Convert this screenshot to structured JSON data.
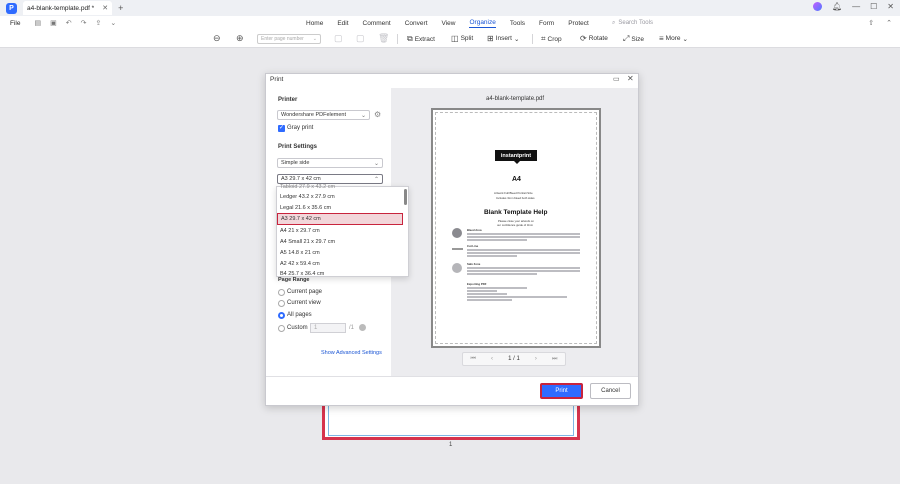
{
  "app": {
    "tab_title": "a4-blank-template.pdf *",
    "logo_letter": "P"
  },
  "menu": {
    "file": "File",
    "items": [
      "Home",
      "Edit",
      "Comment",
      "Convert",
      "View",
      "Organize",
      "Tools",
      "Form",
      "Protect"
    ],
    "active": "Organize",
    "search_placeholder": "Search Tools"
  },
  "toolbar": {
    "page_number_placeholder": "Enter page number",
    "extract": "Extract",
    "split": "Split",
    "insert": "Insert",
    "crop": "Crop",
    "rotate": "Rotate",
    "size": "Size",
    "more": "More"
  },
  "dialog": {
    "title": "Print",
    "printer_label": "Printer",
    "printer_value": "Wondershare PDFelement",
    "gray_print": "Gray print",
    "gray_print_checked": true,
    "print_settings_label": "Print Settings",
    "sides_value": "Simple side",
    "paper_size_value": "A3 29.7 x 42 cm",
    "paper_size_options": [
      "Tabloid 27.9 x 43.2 cm",
      "Ledger 43.2 x 27.9 cm",
      "Legal 21.6 x 35.6 cm",
      "A3 29.7 x 42 cm",
      "A4 21 x 29.7 cm",
      "A4 Small 21 x 29.7 cm",
      "A5 14.8 x 21 cm",
      "A2 42 x 59.4 cm",
      "B4 25.7 x 36.4 cm"
    ],
    "paper_size_selected_index": 3,
    "page_range_label": "Page Range",
    "range_current_page": "Current page",
    "range_current_view": "Current view",
    "range_all_pages": "All pages",
    "range_custom": "Custom",
    "range_custom_value": "1",
    "range_custom_total": "/1",
    "selected_range": "All pages",
    "advanced_settings": "Show Advanced Settings",
    "print_button": "Print",
    "cancel_button": "Cancel"
  },
  "preview": {
    "file_name": "a4-blank-template.pdf",
    "brand": "instantprint",
    "format": "A4",
    "subtitle_1": "Artwork Full Bleed Portrait Size",
    "subtitle_2": "Includes 3mm bleed both sides",
    "heading": "Blank Template Help",
    "intro_1": "Please close your artwork on",
    "intro_2": "our confidence guide of 3mm",
    "item_1_title": "Bleed Area",
    "item_2_title": "Cut Line",
    "item_3_title": "Safe Zone",
    "export_title": "Exporting PDF",
    "page_indicator": "1 / 1"
  },
  "background": {
    "page_number": "1"
  },
  "colors": {
    "accent": "#2f6bff",
    "highlight_border": "#c8243d"
  }
}
